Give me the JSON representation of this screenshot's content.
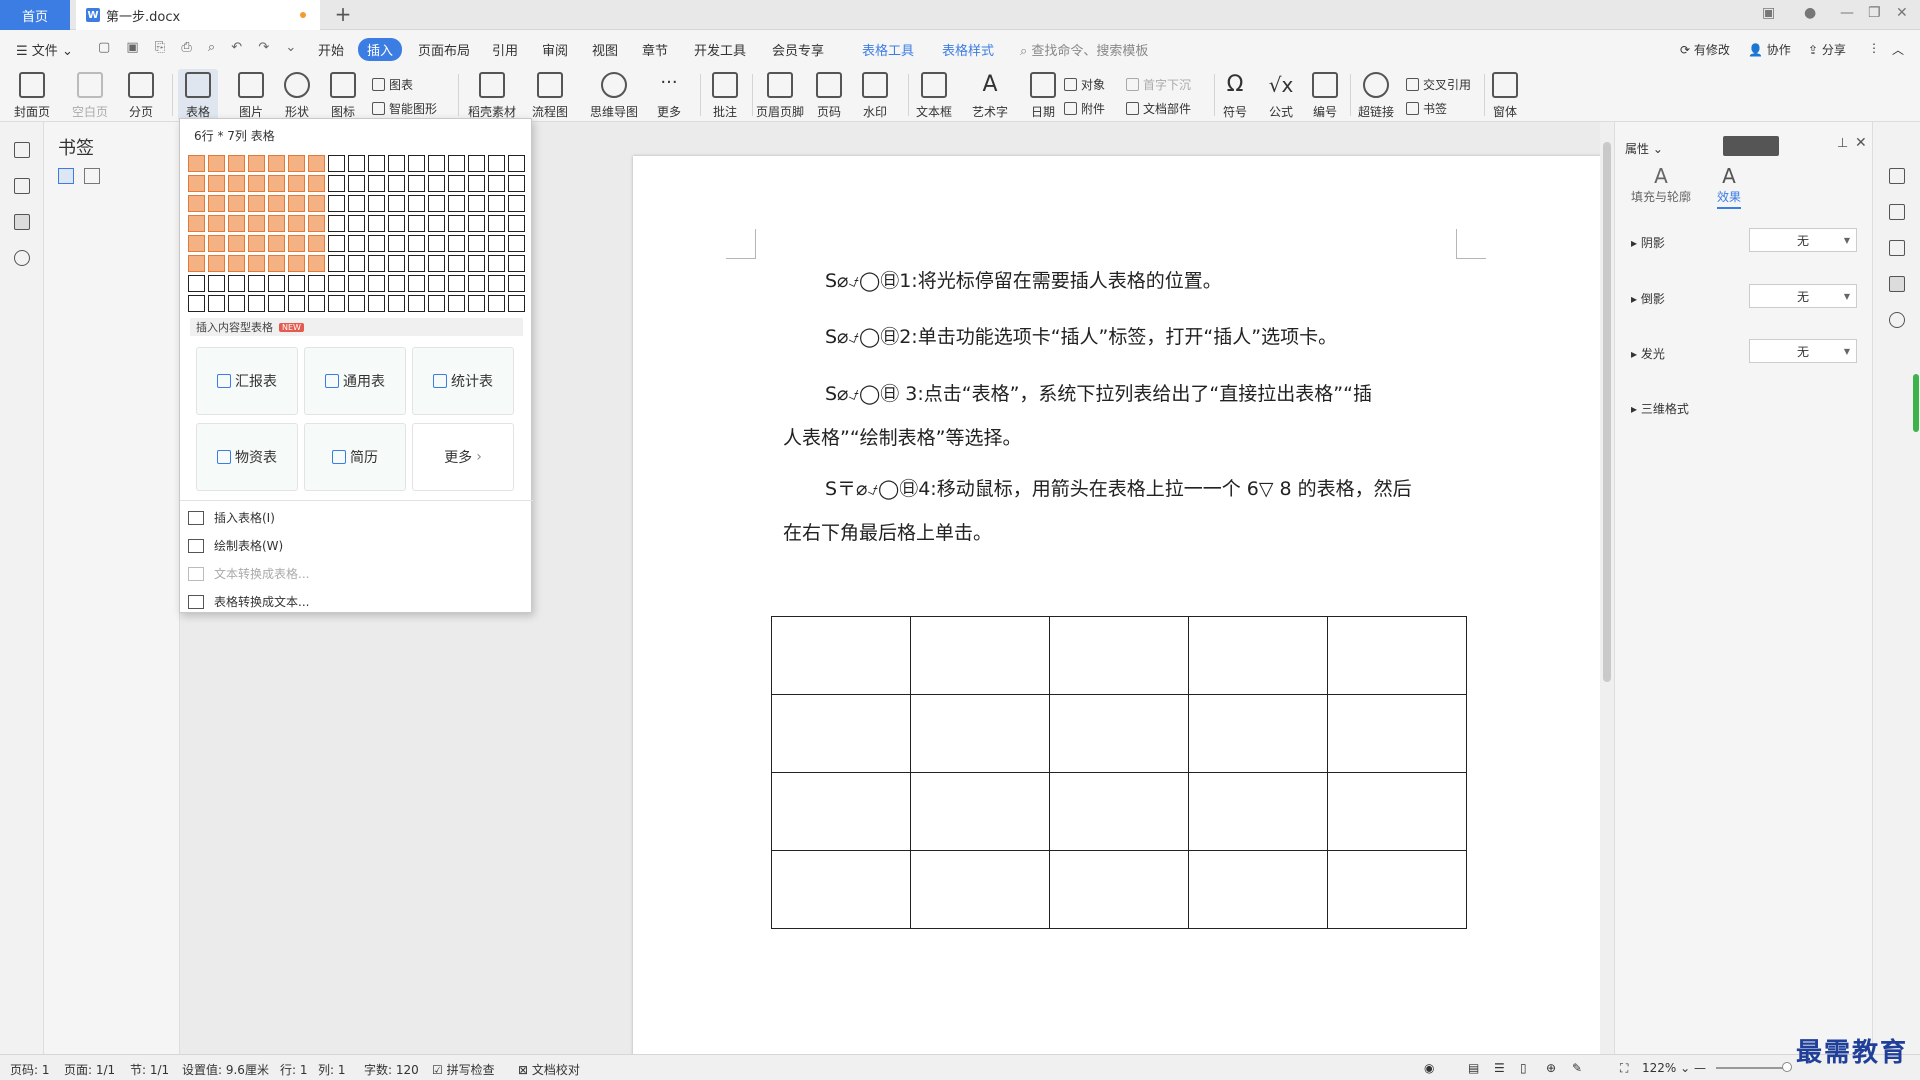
{
  "titlebar": {
    "home_tab": "首页",
    "doc_tab": "第一步.docx",
    "doc_icon": "W",
    "new_tab_symbol": "+"
  },
  "menu": {
    "file": "文件",
    "tabs": [
      "开始",
      "插入",
      "页面布局",
      "引用",
      "审阅",
      "视图",
      "章节",
      "开发工具",
      "会员专享"
    ],
    "active_tab": "插入",
    "context_tabs": [
      "表格工具",
      "表格样式"
    ],
    "search_placeholder": "查找命令、搜索模板",
    "right": {
      "modify": "有修改",
      "collab": "协作",
      "share": "分享"
    }
  },
  "ribbon": {
    "big": [
      "封面页",
      "空白页",
      "分页",
      "表格",
      "图片",
      "形状",
      "图标",
      "稻壳素材",
      "流程图",
      "思维导图",
      "更多",
      "批注",
      "页眉页脚",
      "页码",
      "水印",
      "文本框",
      "艺术字",
      "日期",
      "符号",
      "公式",
      "编号",
      "超链接",
      "窗体"
    ],
    "small": {
      "chart": "图表",
      "smart_shape": "智能图形",
      "object": "对象",
      "attachment": "附件",
      "drop_cap": "首字下沉",
      "doc_parts": "文档部件",
      "cross_ref": "交叉引用",
      "bookmark": "书签"
    }
  },
  "left_pane": {
    "title": "书签"
  },
  "dropdown": {
    "header": "6行 * 7列 表格",
    "grid": {
      "rows": 8,
      "cols": 17,
      "selected_rows": 6,
      "selected_cols": 7
    },
    "section_label": "插入内容型表格",
    "new_badge": "NEW",
    "templates": [
      "汇报表",
      "通用表",
      "统计表",
      "物资表",
      "简历",
      "更多"
    ],
    "items": [
      {
        "label": "插入表格(I)",
        "enabled": true
      },
      {
        "label": "绘制表格(W)",
        "enabled": true
      },
      {
        "label": "文本转换成表格...",
        "enabled": false
      },
      {
        "label": "表格转换成文本...",
        "enabled": true
      }
    ]
  },
  "document": {
    "paragraphs": [
      "S⌀⍻◯㊐1:将光标停留在需要插人表格的位置。",
      "S⌀⍻◯㊐2:单击功能选项卡“插人”标签，打开“插人”选项卡。",
      "S⌀⍻◯㊐ 3:点击“表格”，系统下拉列表给出了“直接拉出表格”“插",
      "人表格”“绘制表格”等选择。",
      "S〒⌀⍻◯㊐4:移动鼠标，用箭头在表格上拉一一个 6▽ 8 的表格，然后",
      "在右下角最后格上单击。"
    ],
    "table": {
      "rows": 4,
      "cols": 5
    }
  },
  "properties": {
    "title": "属性",
    "tabs": [
      "填充与轮廓",
      "效果"
    ],
    "active_tab": "效果",
    "rows": [
      {
        "label": "阴影",
        "value": "无"
      },
      {
        "label": "倒影",
        "value": "无"
      },
      {
        "label": "发光",
        "value": "无"
      },
      {
        "label": "三维格式",
        "value": ""
      }
    ]
  },
  "status": {
    "page_num": "页码: 1",
    "pages": "页面: 1/1",
    "section": "节: 1/1",
    "setting": "设置值: 9.6厘米",
    "row": "行: 1",
    "col": "列: 1",
    "words": "字数: 120",
    "spell": "拼写检查",
    "proof": "文档校对",
    "zoom": "122%"
  },
  "watermark": "最需教育",
  "colors": {
    "accent": "#3c7de4",
    "grid_selected": "#f4b183"
  }
}
